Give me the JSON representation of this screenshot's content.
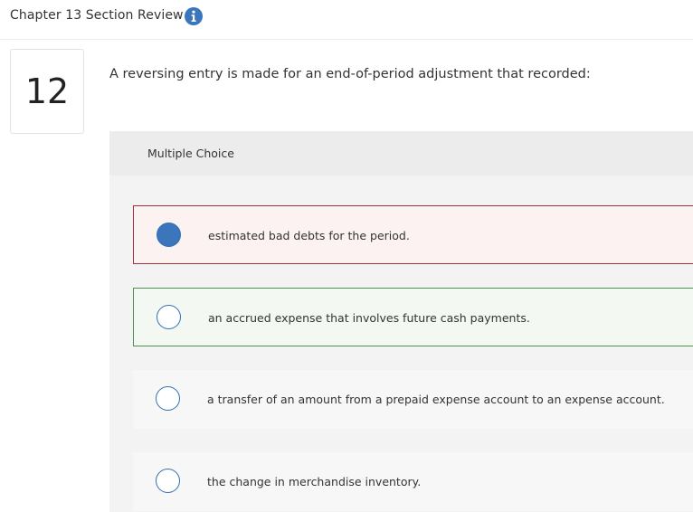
{
  "header": {
    "title": "Chapter 13 Section Review",
    "info_icon": "info-icon"
  },
  "question": {
    "number": "12",
    "text": "A reversing entry is made for an end-of-period adjustment that recorded:"
  },
  "multiple_choice": {
    "label": "Multiple Choice",
    "choices": [
      {
        "text": "estimated bad debts for the period.",
        "selected": true,
        "status": "incorrect"
      },
      {
        "text": "an accrued expense that involves future cash payments.",
        "selected": false,
        "status": "correct"
      },
      {
        "text": "a transfer of an amount from a prepaid expense account to an expense account.",
        "selected": false,
        "status": "none"
      },
      {
        "text": "the change in merchandise inventory.",
        "selected": false,
        "status": "none"
      }
    ]
  },
  "colors": {
    "accent_blue": "#3b76bd",
    "incorrect_border": "#a2323a",
    "correct_border": "#4f8f4f"
  }
}
